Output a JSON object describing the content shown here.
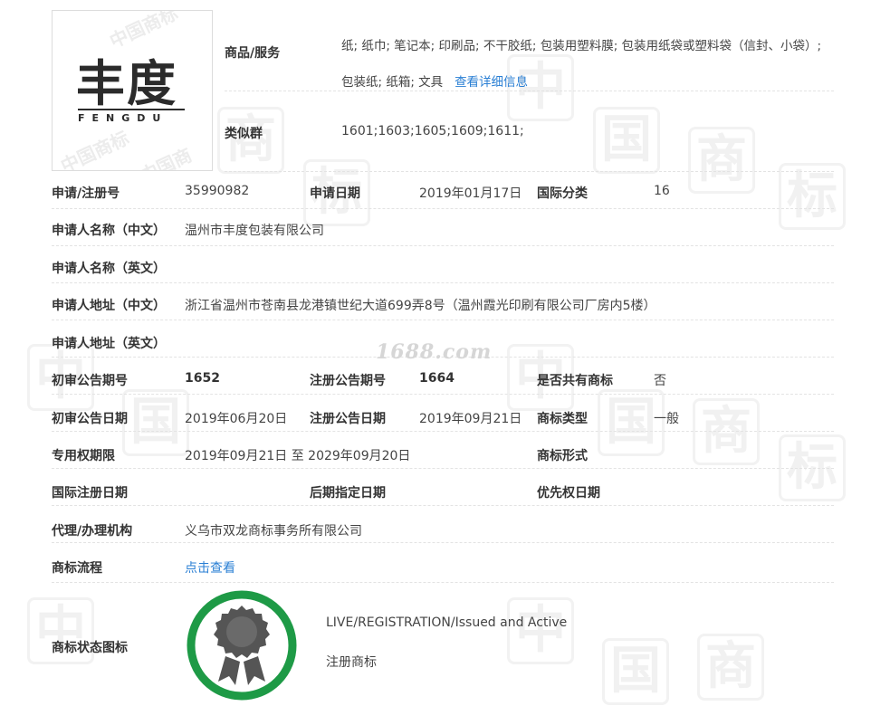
{
  "logo": {
    "text": "丰度",
    "subtext": "FENGDU",
    "watermark": "中国商标"
  },
  "watermark": {
    "site": "1688.com"
  },
  "goods": {
    "label": "商品/服务",
    "value": "纸; 纸巾; 笔记本; 印刷品; 不干胶纸; 包装用塑料膜; 包装用纸袋或塑料袋（信封、小袋）; 包装纸; 纸箱; 文具",
    "link": "查看详细信息"
  },
  "similar": {
    "label": "类似群",
    "value": "1601;1603;1605;1609;1611;"
  },
  "fields": {
    "app_no_label": "申请/注册号",
    "app_no": "35990982",
    "app_date_label": "申请日期",
    "app_date": "2019年01月17日",
    "intl_class_label": "国际分类",
    "intl_class": "16",
    "applicant_cn_label": "申请人名称（中文）",
    "applicant_cn": "温州市丰度包装有限公司",
    "applicant_en_label": "申请人名称（英文）",
    "address_cn_label": "申请人地址（中文）",
    "address_cn": "浙江省温州市苍南县龙港镇世纪大道699弄8号（温州霞光印刷有限公司厂房内5楼）",
    "address_en_label": "申请人地址（英文）",
    "prelim_no_label": "初审公告期号",
    "prelim_no": "1652",
    "reg_no_label": "注册公告期号",
    "reg_no": "1664",
    "shared_label": "是否共有商标",
    "shared": "否",
    "prelim_date_label": "初审公告日期",
    "prelim_date": "2019年06月20日",
    "reg_date_label": "注册公告日期",
    "reg_date": "2019年09月21日",
    "mark_type_label": "商标类型",
    "mark_type": "一般",
    "exclusive_label": "专用权期限",
    "exclusive": "2019年09月21日 至 2029年09月20日",
    "mark_form_label": "商标形式",
    "intl_reg_date_label": "国际注册日期",
    "later_date_label": "后期指定日期",
    "priority_label": "优先权日期",
    "agent_label": "代理/办理机构",
    "agent": "义乌市双龙商标事务所有限公司",
    "flow_label": "商标流程",
    "flow_link": "点击查看",
    "status_label": "商标状态图标",
    "status_en": "LIVE/REGISTRATION/Issued and Active",
    "status_cn": "注册商标"
  },
  "colors": {
    "link": "#2a7fd4",
    "badge_ring": "#1e9a46",
    "badge_seal": "#555555"
  }
}
